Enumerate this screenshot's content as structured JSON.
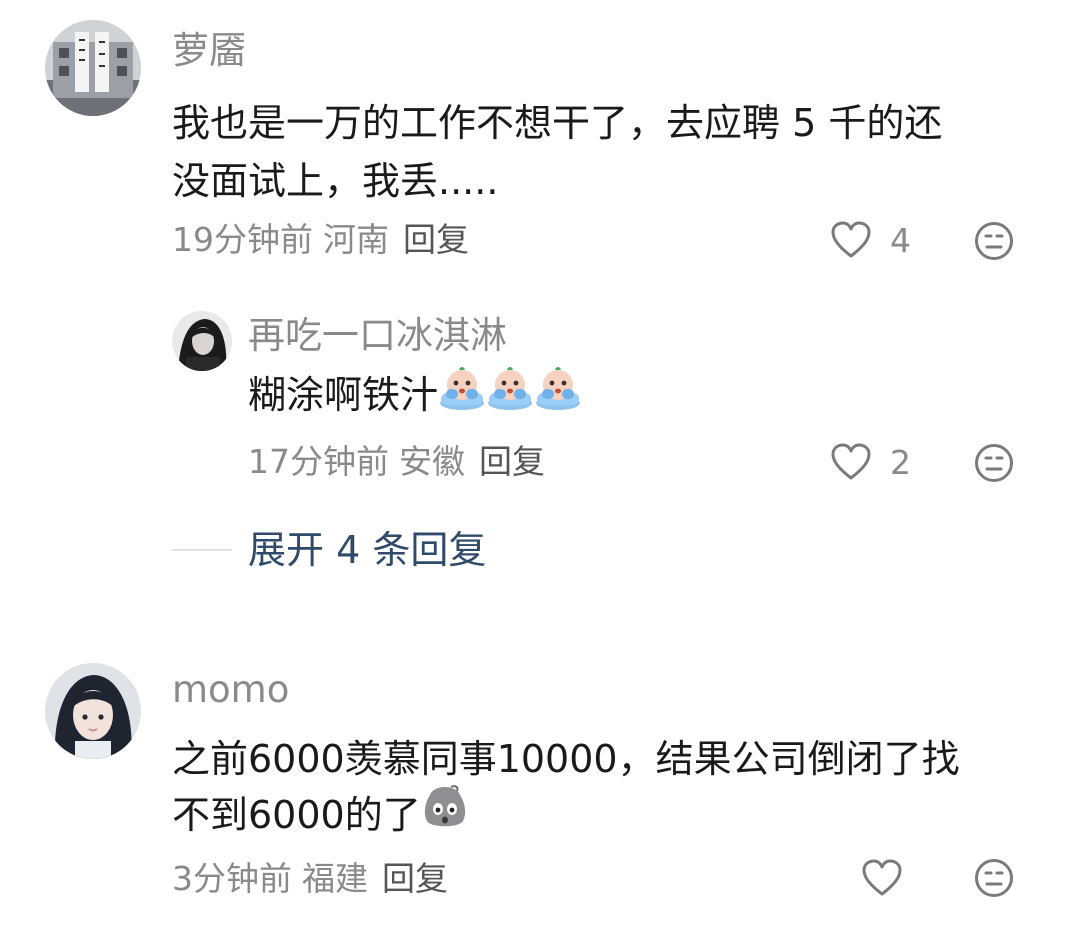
{
  "comments": [
    {
      "username": "萝靥",
      "text_line1": "我也是一万的工作不想干了，去应聘 5 千的还",
      "text_line2": "没面试上，我丢.....",
      "time": "19分钟前",
      "location": "河南",
      "reply_label": "回复",
      "like_count": "4",
      "avatar_icon": "building-photo-avatar"
    },
    {
      "username": "再吃一口冰淇淋",
      "text": "糊涂啊铁汁",
      "emoji_count": 3,
      "emoji_name": "crying-emoji",
      "time": "17分钟前",
      "location": "安徽",
      "reply_label": "回复",
      "like_count": "2",
      "avatar_icon": "dark-hair-avatar"
    },
    {
      "username": "momo",
      "text_line1": "之前6000羡慕同事10000，结果公司倒闭了找",
      "text_line2": "不到6000的了",
      "emoji_name": "grey-shocked-emoji",
      "time": "3分钟前",
      "location": "福建",
      "reply_label": "回复",
      "like_count": "",
      "avatar_icon": "girl-portrait-avatar"
    }
  ],
  "expand_replies_label": "展开 4 条回复",
  "icons": {
    "like": "heart-outline-icon",
    "react": "neutral-face-icon"
  },
  "colors": {
    "text": "#1a1a1a",
    "meta": "#8a8a8a",
    "link": "#2f4a6a"
  }
}
